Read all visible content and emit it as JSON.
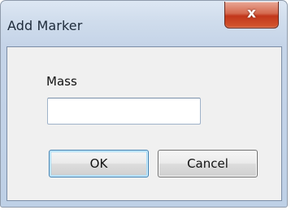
{
  "window": {
    "title": "Add Marker",
    "close_glyph": "x",
    "close_icon": "close-icon"
  },
  "form": {
    "mass_label": "Mass",
    "mass_value": "",
    "mass_placeholder": ""
  },
  "buttons": {
    "ok_label": "OK",
    "cancel_label": "Cancel"
  },
  "colors": {
    "close_button_red": "#c2371b",
    "client_background": "#f0f0f0",
    "title_bar": "#cfdcec"
  }
}
